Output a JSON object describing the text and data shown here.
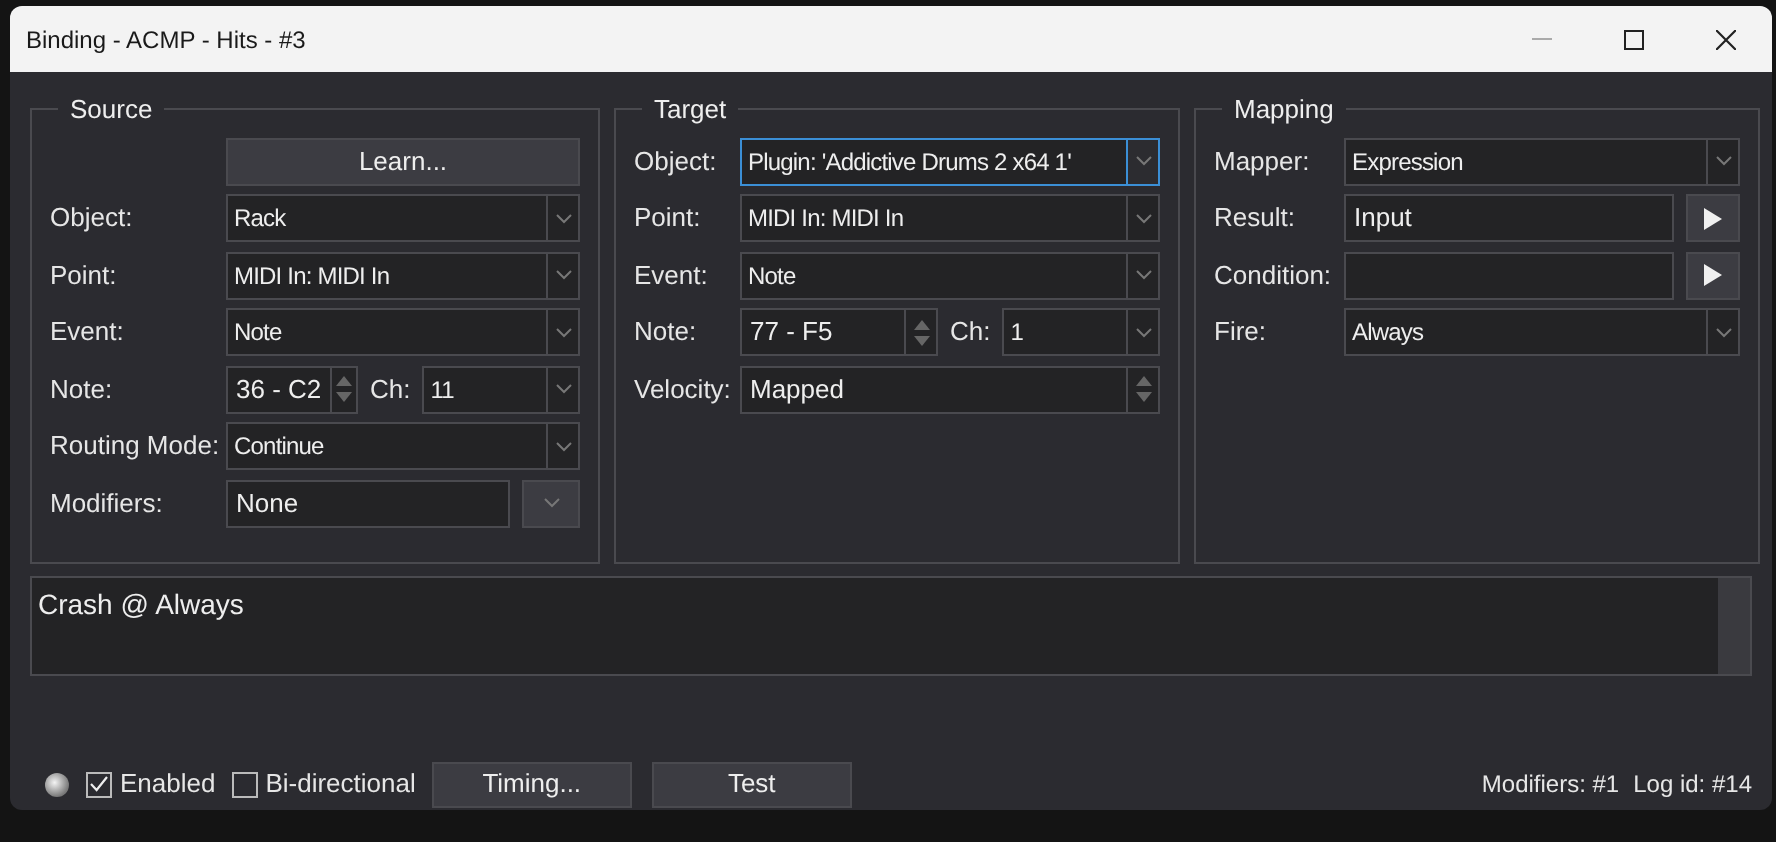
{
  "window": {
    "title": "Binding - ACMP - Hits - #3"
  },
  "source": {
    "title": "Source",
    "learn_button": "Learn...",
    "rows": [
      {
        "kind": "combo",
        "label": "Object:",
        "value": "Rack",
        "focused": false
      },
      {
        "kind": "combo",
        "label": "Point:",
        "value": "MIDI In: MIDI In",
        "focused": false
      },
      {
        "kind": "combo",
        "label": "Event:",
        "value": "Note",
        "focused": false
      },
      {
        "kind": "note",
        "label": "Note:",
        "value": "36 - C2",
        "channel_label": "Ch:",
        "channel_value": "11"
      },
      {
        "kind": "combo",
        "label": "Routing Mode:",
        "value": "Continue",
        "focused": false
      },
      {
        "kind": "combo_button",
        "label": "Modifiers:",
        "value": "None"
      }
    ]
  },
  "target": {
    "title": "Target",
    "rows": [
      {
        "kind": "combo",
        "label": "Object:",
        "value": "Plugin: 'Addictive Drums 2 x64 1'",
        "focused": true
      },
      {
        "kind": "combo",
        "label": "Point:",
        "value": "MIDI In: MIDI In",
        "focused": false
      },
      {
        "kind": "combo",
        "label": "Event:",
        "value": "Note",
        "focused": false
      },
      {
        "kind": "note",
        "label": "Note:",
        "value": "77 - F5",
        "channel_label": "Ch:",
        "channel_value": "1"
      },
      {
        "kind": "spin",
        "label": "Velocity:",
        "value": "Mapped"
      }
    ]
  },
  "mapping": {
    "title": "Mapping",
    "rows": [
      {
        "kind": "combo",
        "label": "Mapper:",
        "value": "Expression",
        "focused": false
      },
      {
        "kind": "text_play",
        "label": "Result:",
        "value": "Input"
      },
      {
        "kind": "text_play",
        "label": "Condition:"
      },
      {
        "kind": "combo",
        "label": "Fire:",
        "value": "Always",
        "focused": false
      }
    ]
  },
  "log": {
    "text": "Crash @ Always"
  },
  "footer": {
    "checkboxes": [
      {
        "label": "Enabled",
        "checked": true
      },
      {
        "label": "Bi-directional",
        "checked": false
      }
    ],
    "buttons": [
      "Timing...",
      "Test"
    ],
    "status": [
      "Modifiers: #1",
      "Log id: #14"
    ]
  }
}
